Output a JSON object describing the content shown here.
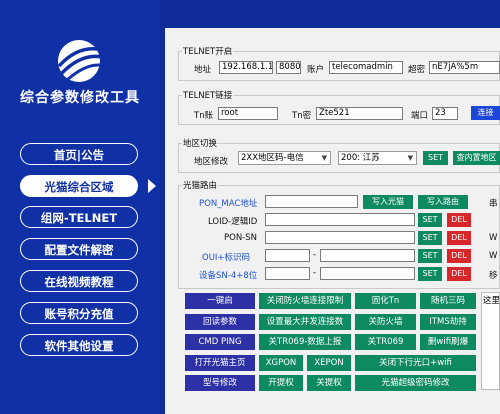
{
  "app": {
    "title": "综合参数修改工具"
  },
  "nav": {
    "items": [
      {
        "label": "首页|公告"
      },
      {
        "label": "光猫综合区域"
      },
      {
        "label": "组网-TELNET"
      },
      {
        "label": "配置文件解密"
      },
      {
        "label": "在线视频教程"
      },
      {
        "label": "账号积分充值"
      },
      {
        "label": "软件其他设置"
      }
    ]
  },
  "telnet_open": {
    "legend": "TELNET开启",
    "address_label": "地址",
    "address_value": "192.168.1.1",
    "port_value": "8080",
    "account_label": "账户",
    "account_value": "telecomadmin",
    "password_label": "超密",
    "password_value": "nE7jA%5m"
  },
  "telnet_link": {
    "legend": "TELNET链接",
    "tn_account_label": "Tn账",
    "tn_account_value": "root",
    "tn_password_label": "Tn密",
    "tn_password_value": "Zte521",
    "port_label": "端口",
    "port_value": "23",
    "connect_label": "连接"
  },
  "region": {
    "legend": "地区切换",
    "modify_label": "地区修改",
    "region_select": "2XX地区码-电信",
    "province_select": "200: 江苏",
    "set_label": "SET",
    "query_label": "查内置地区"
  },
  "optical_routing": {
    "legend": "光猫路由",
    "pon_mac_label": "PON_MAC地址",
    "write_optical_label": "写入光猫",
    "write_routing_label": "写入路由",
    "loid_label": "LOID-逻辑ID",
    "pon_sn_label": "PON-SN",
    "oui_label": "OUI+标识码",
    "device_sn_label": "设备SN-4+8位",
    "oui_dash": "-",
    "sn_dash": "-",
    "set_label": "SET",
    "del_label": "DEL",
    "right_partial": [
      "串",
      "W",
      "W",
      "移"
    ]
  },
  "actions": {
    "row1": [
      "一键启",
      "关闭防火墙连接限制",
      "固化Tn",
      "随机三码"
    ],
    "row2": [
      "回读参数",
      "设置最大并发连接数",
      "关防火墙",
      "ITMS劫持"
    ],
    "row3": [
      "CMD PING",
      "关TR069-数据上报",
      "关TR069",
      "删wifi刷爆"
    ],
    "row4": [
      "打开光猫主页",
      "XGPON",
      "XEPON",
      "关闭下行光口+wifi"
    ],
    "row5": [
      "型号修改",
      "开提权",
      "关提权",
      "光猫超级密码修改"
    ]
  },
  "log": {
    "text": "这里"
  }
}
